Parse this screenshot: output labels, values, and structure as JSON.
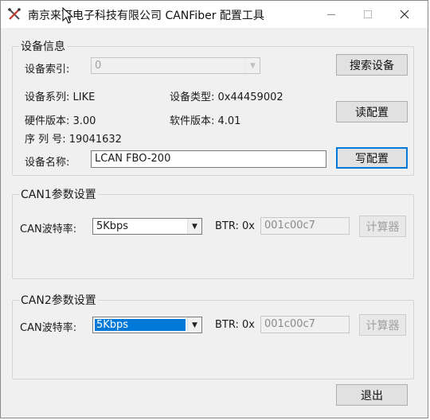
{
  "window": {
    "title": "南京来可电子科技有限公司 CANFiber 配置工具",
    "minimize_label": "—",
    "maximize_label": "☐",
    "close_label": "✕"
  },
  "device_info": {
    "group_title": "设备信息",
    "index_label": "设备索引:",
    "index_value": "0",
    "search_button": "搜索设备",
    "series_label": "设备系列: LIKE",
    "type_label": "设备类型: 0x44459002",
    "read_button": "读配置",
    "hw_label": "硬件版本: 3.00",
    "sw_label": "软件版本: 4.01",
    "serial_label": "序 列 号: 19041632",
    "name_label": "设备名称:",
    "name_value": "LCAN FBO-200",
    "write_button": "写配置"
  },
  "can1": {
    "group_title": "CAN1参数设置",
    "baud_label": "CAN波特率:",
    "baud_value": "5Kbps",
    "btr_label": "BTR: 0x",
    "btr_value": "001c00c7",
    "calc_button": "计算器"
  },
  "can2": {
    "group_title": "CAN2参数设置",
    "baud_label": "CAN波特率:",
    "baud_value": "5Kbps",
    "btr_label": "BTR: 0x",
    "btr_value": "001c00c7",
    "calc_button": "计算器"
  },
  "exit_button": "退出",
  "colors": {
    "accent": "#0078d7",
    "window_bg": "#f0f0f0",
    "button_bg": "#e1e1e1"
  }
}
